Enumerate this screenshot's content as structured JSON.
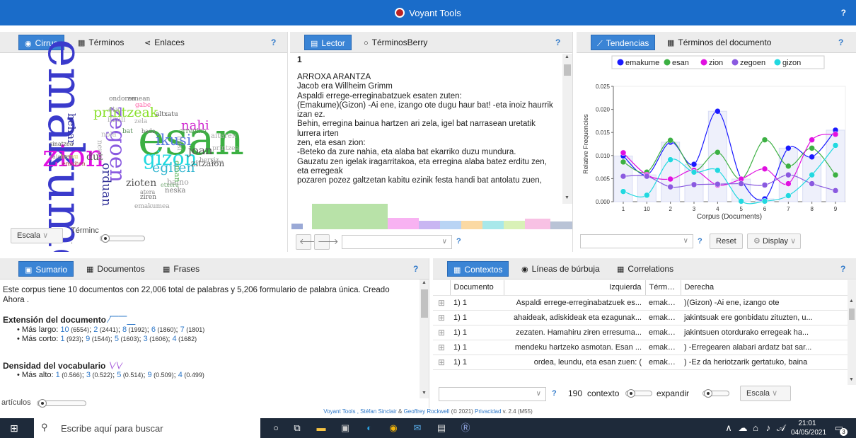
{
  "app": {
    "title": "Voyant Tools",
    "help": "?"
  },
  "cirrus_panel": {
    "tabs": [
      "Cirrus",
      "Términos",
      "Enlaces"
    ],
    "help": "?",
    "scale_label": "Escala",
    "terms_label": "Términc",
    "terms_label2": ":",
    "cloud_words": [
      "emakume",
      "esan",
      "zion",
      "zegoen",
      "gizon",
      "printzeak",
      "nahi",
      "ikusi",
      "egiten",
      "behar",
      "orduan",
      "dut",
      "zioten",
      "joan",
      "zitzaion",
      "bat",
      "baino",
      "bada",
      "erregina",
      "etxera",
      "emakumea",
      "eman",
      "ondoren",
      "zenean",
      "gabe",
      "itzuli",
      "zela",
      "neska",
      "nola",
      "altxatu",
      "hasi",
      "aitaren",
      "lore",
      "hamu",
      "printzea",
      "eta",
      "berriz",
      "saiatzen",
      "ziren",
      "atera",
      "sinatzea",
      "emaiten",
      "neure"
    ]
  },
  "reader_panel": {
    "tabs": [
      "Lector",
      "TérminosBerry"
    ],
    "help": "?",
    "doc_number": "1",
    "lines": [
      "ARROXA ARANTZA",
      "Jacob era Willheim Grimm",
      "Aspaldi errege-erreginabatzuek esaten zuten:",
      "(Emakume)(Gizon) -Ai ene, izango ote dugu haur bat! -eta inoiz haurrik",
      "izan ez.",
      "Behin, erregina bainua hartzen ari zela, igel bat narrasean uretatik",
      "lurrera irten",
      "zen, eta esan zion:",
      "-Beteko da zure nahia, eta alaba bat ekarriko duzu mundura.",
      "Gauzatu zen igelak iragarritakoa, eta erregina alaba batez erditu zen,",
      "eta erregeak",
      "pozaren pozez galtzetan kabitu ezinik festa handi bat antolatu zuen,"
    ],
    "nav_help": "?"
  },
  "trends_panel": {
    "tabs": [
      "Tendencias",
      "Términos del documento"
    ],
    "help": "?",
    "reset_label": "Reset",
    "display_label": "Display",
    "combo_help": "?"
  },
  "chart_data": {
    "type": "line",
    "xlabel": "Corpus (Documents)",
    "ylabel": "Relative Frequencies",
    "categories": [
      "1",
      "10",
      "2",
      "3",
      "4",
      "5",
      "6",
      "7",
      "8",
      "9"
    ],
    "ylim": [
      0,
      0.025
    ],
    "yticks": [
      "0.000",
      "0.005",
      "0.010",
      "0.015",
      "0.020",
      "0.025"
    ],
    "legend_position": "top",
    "series": [
      {
        "name": "emakume",
        "color": "#1a1aff",
        "values": [
          0.0099,
          0.0058,
          0.0129,
          0.0081,
          0.0196,
          0.0049,
          0.0006,
          0.0116,
          0.0097,
          0.0155
        ]
      },
      {
        "name": "esan",
        "color": "#3cb043",
        "values": [
          0.0086,
          0.0064,
          0.0133,
          0.0068,
          0.0107,
          0.0049,
          0.0134,
          0.0077,
          0.0116,
          0.0058
        ]
      },
      {
        "name": "zion",
        "color": "#e010e0",
        "values": [
          0.0106,
          0.0058,
          0.0049,
          0.0068,
          0.0036,
          0.0049,
          0.0071,
          0.0039,
          0.0134,
          0.0146
        ]
      },
      {
        "name": "zegoen",
        "color": "#8a5ae0",
        "values": [
          0.0055,
          0.0055,
          0.0032,
          0.0037,
          0.0038,
          0.0039,
          0.0036,
          0.0058,
          0.0039,
          0.0024
        ]
      },
      {
        "name": "gizon",
        "color": "#22d8e0",
        "values": [
          0.0022,
          0.0014,
          0.0091,
          0.0064,
          0.0068,
          0.0001,
          0.0001,
          0.0013,
          0.0058,
          0.0122
        ]
      }
    ]
  },
  "summary_panel": {
    "tabs": [
      "Sumario",
      "Documentos",
      "Frases"
    ],
    "help": "?",
    "intro": "Este corpus tiene 10 documentos con 22,006 total de palabras y 5,206 formulario de palabra única. Creado Ahora .",
    "length_title": "Extensión del documento",
    "longest_label": "Más largo:",
    "longest": [
      [
        "10",
        "(6554)"
      ],
      [
        "2",
        "(2441)"
      ],
      [
        "8",
        "(1992)"
      ],
      [
        "6",
        "(1860)"
      ],
      [
        "7",
        "(1801)"
      ]
    ],
    "shortest_label": "Más corto:",
    "shortest": [
      [
        "1",
        "(923)"
      ],
      [
        "9",
        "(1544)"
      ],
      [
        "5",
        "(1603)"
      ],
      [
        "3",
        "(1606)"
      ],
      [
        "4",
        "(1682)"
      ]
    ],
    "density_title": "Densidad del vocabulario",
    "highest_label": "Más alto:",
    "highest": [
      [
        "1",
        "(0.566)"
      ],
      [
        "3",
        "(0.522)"
      ],
      [
        "5",
        "(0.514)"
      ],
      [
        "9",
        "(0.509)"
      ],
      [
        "4",
        "(0.499)"
      ]
    ],
    "articles_label": "artículos"
  },
  "contexts_panel": {
    "tabs": [
      "Contextos",
      "Líneas de búrbuja",
      "Correlations"
    ],
    "help": "?",
    "columns": [
      "Documento",
      "Izquierda",
      "Términos",
      "Derecha"
    ],
    "rows": [
      {
        "doc": "1) 1",
        "left": "Aspaldi errege-erreginabatzuek es...",
        "term": "emaku...",
        "right": ")(Gizon) -Ai ene, izango ote"
      },
      {
        "doc": "1) 1",
        "left": "ahaideak, adiskideak eta ezagunak...",
        "term": "emaku...",
        "right": "jakintsuak ere gonbidatu zituzten, u..."
      },
      {
        "doc": "1) 1",
        "left": "zezaten. Hamahiru ziren erresuma...",
        "term": "emaku...",
        "right": "jakintsuen otordurako erregeak ha..."
      },
      {
        "doc": "1) 1",
        "left": "mendeku hartzeko asmotan. Esan ...",
        "term": "emaku...",
        "right": ") -Erregearen alabari ardatz bat sar..."
      },
      {
        "doc": "1) 1",
        "left": "ordea, leundu, eta esan zuen: (",
        "term": "emaku...",
        "right": ") -Ez da heriotzarik gertatuko, baina"
      }
    ],
    "count": "190",
    "context_label": "contexto",
    "expand_label": "expandir",
    "scale_label": "Escala",
    "combo_help": "?"
  },
  "footer": {
    "text_pre": "Voyant Tools ,",
    "author1": "Stéfan Sinclair",
    "amp": "&",
    "author2": "Geoffrey Rockwell",
    "year": "(© 2021)",
    "privacy": "Privacidad",
    "version": "v. 2.4 (M55)"
  },
  "taskbar": {
    "search_placeholder": "Escribe aquí para buscar",
    "time": "21:01",
    "date": "04/05/2021",
    "notif": "3"
  }
}
